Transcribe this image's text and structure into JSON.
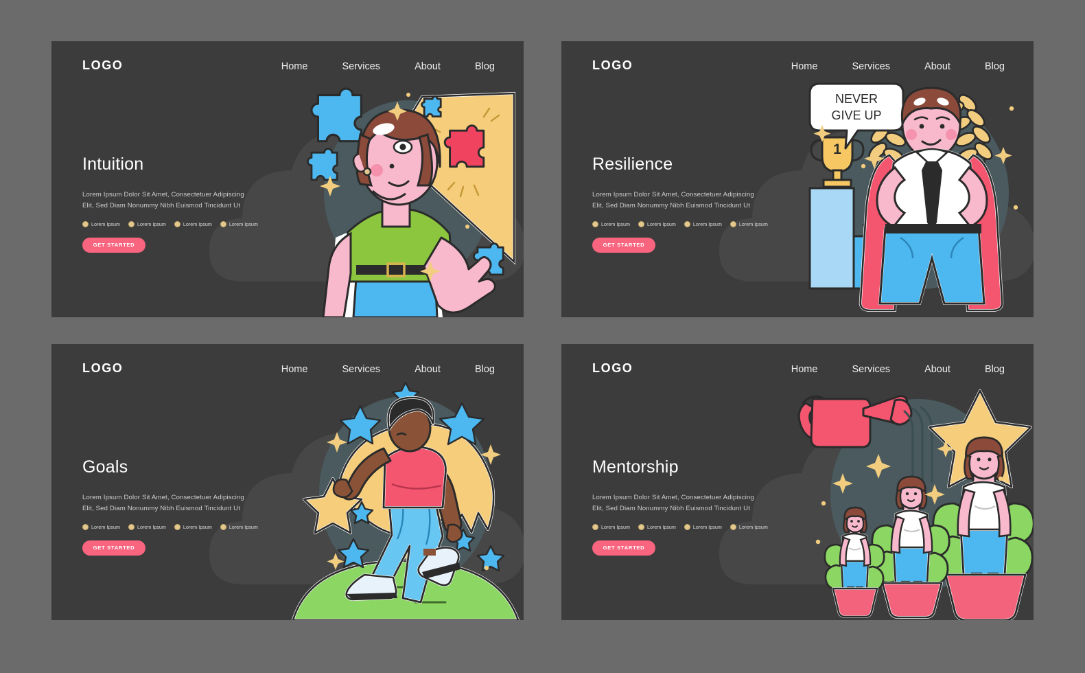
{
  "meta": {
    "background_color": "#6b6b6b",
    "panel_color": "#3c3c3c",
    "accent_pink": "#f9647f",
    "bullet_gold": "#e3c98f",
    "blob_teal": "#4a5a5e",
    "cloud_gray": "#474747"
  },
  "common": {
    "logo": "LOGO",
    "nav": [
      {
        "label": "Home"
      },
      {
        "label": "Services"
      },
      {
        "label": "About"
      },
      {
        "label": "Blog"
      }
    ],
    "paragraph_line1": "Lorem Ipsum Dolor Sit Amet, Consectetuer Adipiscing",
    "paragraph_line2": "Elit, Sed Diam Nonummy Nibh Euismod Tincidunt Ut",
    "bullets": [
      {
        "label": "Lorem Ipsum"
      },
      {
        "label": "Lorem Ipsum"
      },
      {
        "label": "Lorem Ipsum"
      },
      {
        "label": "Lorem Ipsum"
      }
    ],
    "cta_label": "GET STARTED"
  },
  "panels": [
    {
      "id": "intuition",
      "heading": "Intuition",
      "illustration": "woman-with-puzzle-pieces-and-insight-beam",
      "illustration_colors": {
        "shirt": "#8cc63f",
        "skirt": "#4db8f0",
        "skin": "#f9b9cd",
        "hair": "#8b4a3a",
        "beam": "#f6cd7b",
        "puzzle_highlight": "#ef4360",
        "puzzle_blue": "#4db8f0",
        "belt": "#2b2b2b"
      }
    },
    {
      "id": "resilience",
      "heading": "Resilience",
      "illustration": "hero-man-with-cape-trophy-and-laurel",
      "speech_bubble_line1": "NEVER",
      "speech_bubble_line2": "GIVE UP",
      "trophy_number": "1",
      "illustration_colors": {
        "cape": "#f4556f",
        "shirt": "#ffffff",
        "tie": "#2b2b2b",
        "shorts": "#4db8f0",
        "skin": "#f9b9cd",
        "trophy": "#f6c763",
        "laurel": "#f2cd7f",
        "podium_light": "#a8d8f5",
        "arrow_green": "#5cb85c"
      }
    },
    {
      "id": "goals",
      "heading": "Goals",
      "illustration": "man-running-on-hill-with-shooting-star",
      "illustration_colors": {
        "shirt": "#f4556f",
        "pants": "#67c6f2",
        "skin": "#8a5338",
        "hair": "#2b2b2b",
        "comet": "#f6cd7b",
        "hill": "#8cd663",
        "stars_blue": "#4db8f0",
        "shoes": "#e8f2fa"
      }
    },
    {
      "id": "mentorship",
      "heading": "Mentorship",
      "illustration": "watering-can-growing-women-in-pots-with-star",
      "illustration_colors": {
        "watering_can": "#f4556f",
        "pots": "#f4637c",
        "leaves": "#8cd663",
        "blouse": "#ffffff",
        "skirt": "#4db8f0",
        "skin": "#f9b9cd",
        "star": "#f6cd7b",
        "hair": "#8b4a3a"
      }
    }
  ]
}
